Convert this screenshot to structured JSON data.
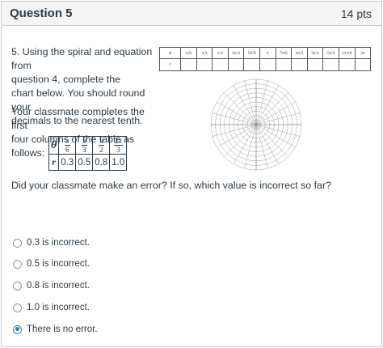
{
  "header": {
    "title": "Question 5",
    "points": "14 pts"
  },
  "prompt": {
    "lines": [
      "5. Using the spiral and equation from",
      "question 4, complete the",
      "chart below. You should round your",
      "decimals to the nearest tenth."
    ],
    "classmate_lines": [
      "Your classmate completes the first",
      "four columns of the table as follows:"
    ]
  },
  "classmate_table": {
    "theta_symbol": "θ",
    "r_symbol": "r",
    "theta_values": [
      {
        "num": "π",
        "den": "6"
      },
      {
        "num": "π",
        "den": "3"
      },
      {
        "num": "π",
        "den": "2"
      },
      {
        "num": "2π",
        "den": "3"
      }
    ],
    "r_values": [
      "0.3",
      "0.5",
      "0.8",
      "1.0"
    ]
  },
  "question_text": "Did your classmate make an error? If so, which value is incorrect so far?",
  "chart_table": {
    "theta_header": "θ",
    "r_header": "r",
    "columns": [
      "π/6",
      "π/3",
      "π/2",
      "2π/3",
      "5π/6",
      "π",
      "7π/6",
      "4π/3",
      "3π/2",
      "5π/3",
      "11π/6",
      "2π"
    ]
  },
  "answers": [
    {
      "label": "0.3 is incorrect.",
      "checked": false
    },
    {
      "label": "0.5 is incorrect.",
      "checked": false
    },
    {
      "label": "0.8 is incorrect.",
      "checked": false
    },
    {
      "label": "1.0 is incorrect.",
      "checked": false
    },
    {
      "label": "There is no error.",
      "checked": true
    }
  ],
  "colors": {
    "accent": "#2b7abc",
    "text": "#2d3b45",
    "border": "#c7cdd1",
    "header_bg": "#f5f5f5"
  }
}
